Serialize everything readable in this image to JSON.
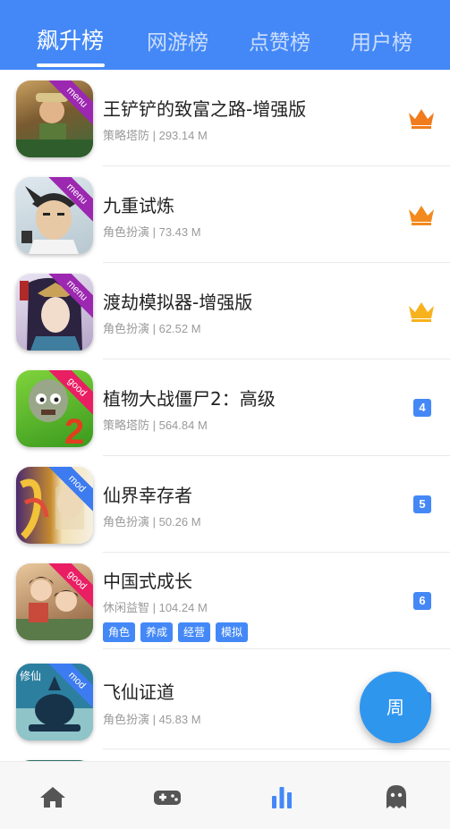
{
  "tabs": [
    {
      "label": "飙升榜",
      "active": true
    },
    {
      "label": "网游榜",
      "active": false
    },
    {
      "label": "点赞榜",
      "active": false
    },
    {
      "label": "用户榜",
      "active": false
    }
  ],
  "colors": {
    "primary": "#4488f7",
    "fab": "#2f96ee",
    "crown_gold_1": "#f07c1e",
    "crown_gold_3": "#f7b21d"
  },
  "apps": [
    {
      "name": "王铲铲的致富之路-增强版",
      "meta": "策略塔防 | 293.14 M",
      "corner": "menu",
      "corner_color": "#9c27b0",
      "rank_icon": "crown-icon",
      "rank": ""
    },
    {
      "name": "九重试炼",
      "meta": "角色扮演 | 73.43 M",
      "corner": "menu",
      "corner_color": "#9c27b0",
      "rank_icon": "crown-icon",
      "rank": ""
    },
    {
      "name": "渡劫模拟器-增强版",
      "meta": "角色扮演 | 62.52 M",
      "corner": "menu",
      "corner_color": "#9c27b0",
      "rank_icon": "crown-icon",
      "rank": ""
    },
    {
      "name": "植物大战僵尸2：高级",
      "meta": "策略塔防 | 564.84 M",
      "corner": "good",
      "corner_color": "#e91e63",
      "rank": "4"
    },
    {
      "name": "仙界幸存者",
      "meta": "角色扮演 | 50.26 M",
      "corner": "mod",
      "corner_color": "#3d7bf0",
      "rank": "5"
    },
    {
      "name": "中国式成长",
      "meta": "休闲益智 | 104.24 M",
      "corner": "good",
      "corner_color": "#e91e63",
      "rank": "6",
      "tags": [
        "角色",
        "养成",
        "经营",
        "模拟"
      ]
    },
    {
      "name": "飞仙证道",
      "meta": "角色扮演 | 45.83 M",
      "corner": "mod",
      "corner_color": "#3d7bf0",
      "rank": "7"
    }
  ],
  "fab": {
    "label": "周"
  },
  "bottom_nav": [
    {
      "icon": "home-icon"
    },
    {
      "icon": "gamepad-icon"
    },
    {
      "icon": "bar-chart-icon",
      "active": true
    },
    {
      "icon": "ghost-icon"
    }
  ]
}
